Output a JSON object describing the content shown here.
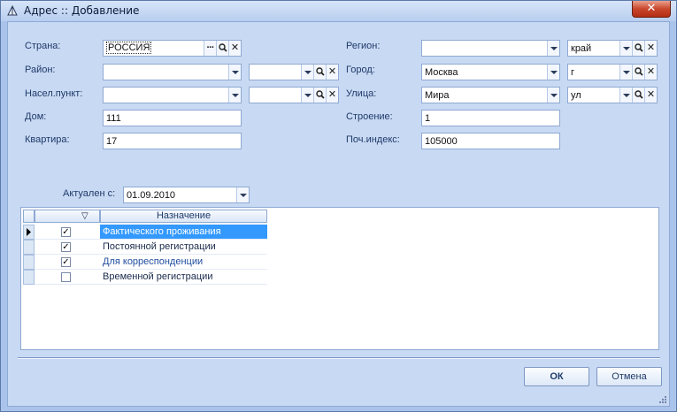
{
  "window": {
    "title": "Адрес :: Добавление",
    "close_label": "✕"
  },
  "labels": {
    "country": "Страна:",
    "district": "Район:",
    "locality": "Насел.пункт:",
    "house": "Дом:",
    "apartment": "Квартира:",
    "region": "Регион:",
    "city": "Город:",
    "street": "Улица:",
    "building": "Строение:",
    "postcode": "Поч.индекс:",
    "actual_from": "Актуален с:"
  },
  "fields": {
    "country": "РОССИЯ",
    "district": "",
    "district_type": "",
    "locality": "",
    "locality_type": "",
    "house": "111",
    "apartment": "17",
    "region": "",
    "region_type": "край",
    "city": "Москва",
    "city_type": "г",
    "street": "Мира",
    "street_type": "ул",
    "building": "1",
    "postcode": "105000",
    "actual_from": "01.09.2010"
  },
  "grid": {
    "filter_glyph": "▽",
    "column_name": "Назначение",
    "rows": [
      {
        "name": "Фактического проживания",
        "checked": true,
        "selected": true,
        "current": true,
        "link": false
      },
      {
        "name": "Постоянной регистрации",
        "checked": true,
        "selected": false,
        "current": false,
        "link": false
      },
      {
        "name": "Для корреспонденции",
        "checked": true,
        "selected": false,
        "current": false,
        "link": true
      },
      {
        "name": "Временной регистрации",
        "checked": false,
        "selected": false,
        "current": false,
        "link": false
      }
    ]
  },
  "buttons": {
    "ok": "ОК",
    "cancel": "Отмена"
  },
  "icons": {
    "search": "search-icon",
    "clear": "clear-icon",
    "browse": "browse-icon",
    "dropdown": "chevron-down-icon"
  },
  "colors": {
    "selection": "#3399ff",
    "link_text": "#1f4d9e",
    "window_bg": "#c8d9f3"
  }
}
